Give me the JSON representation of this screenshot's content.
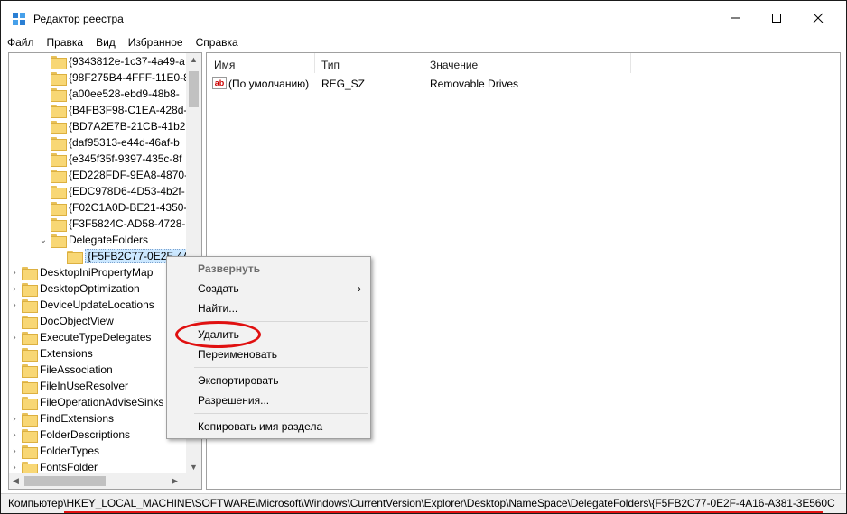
{
  "window": {
    "title": "Редактор реестра",
    "minimize_glyph": "—",
    "maximize_glyph": "☐",
    "close_glyph": "✕"
  },
  "menu": [
    "Файл",
    "Правка",
    "Вид",
    "Избранное",
    "Справка"
  ],
  "tree": {
    "items": [
      {
        "label": "{9343812e-1c37-4a49-a"
      },
      {
        "label": "{98F275B4-4FFF-11E0-8"
      },
      {
        "label": "{a00ee528-ebd9-48b8-"
      },
      {
        "label": "{B4FB3F98-C1EA-428d-"
      },
      {
        "label": "{BD7A2E7B-21CB-41b2"
      },
      {
        "label": "{daf95313-e44d-46af-b"
      },
      {
        "label": "{e345f35f-9397-435c-8f"
      },
      {
        "label": "{ED228FDF-9EA8-4870-"
      },
      {
        "label": "{EDC978D6-4D53-4b2f-"
      },
      {
        "label": "{F02C1A0D-BE21-4350-"
      },
      {
        "label": "{F3F5824C-AD58-4728-"
      },
      {
        "label": "DelegateFolders"
      },
      {
        "label": "{F5FB2C77-0E2F-4A"
      },
      {
        "label": "DesktopIniPropertyMap"
      },
      {
        "label": "DesktopOptimization"
      },
      {
        "label": "DeviceUpdateLocations"
      },
      {
        "label": "DocObjectView"
      },
      {
        "label": "ExecuteTypeDelegates"
      },
      {
        "label": "Extensions"
      },
      {
        "label": "FileAssociation"
      },
      {
        "label": "FileInUseResolver"
      },
      {
        "label": "FileOperationAdviseSinks"
      },
      {
        "label": "FindExtensions"
      },
      {
        "label": "FolderDescriptions"
      },
      {
        "label": "FolderTypes"
      },
      {
        "label": "FontsFolder"
      }
    ],
    "selected": "{F5FB2C77-0E2F-4A"
  },
  "list": {
    "headers": {
      "name": "Имя",
      "type": "Тип",
      "value": "Значение"
    },
    "rows": [
      {
        "icon": "string-value-icon",
        "icon_text": "ab",
        "name": "(По умолчанию)",
        "type": "REG_SZ",
        "value": "Removable Drives"
      }
    ]
  },
  "context_menu": {
    "expand": "Развернуть",
    "create": "Создать",
    "find": "Найти...",
    "delete": "Удалить",
    "rename": "Переименовать",
    "export": "Экспортировать",
    "permissions": "Разрешения...",
    "copy_key_name": "Копировать имя раздела"
  },
  "statusbar": {
    "path": "Компьютер\\HKEY_LOCAL_MACHINE\\SOFTWARE\\Microsoft\\Windows\\CurrentVersion\\Explorer\\Desktop\\NameSpace\\DelegateFolders\\{F5FB2C77-0E2F-4A16-A381-3E560C"
  },
  "colors": {
    "highlight": "#e01010",
    "selection": "#cce8ff"
  }
}
